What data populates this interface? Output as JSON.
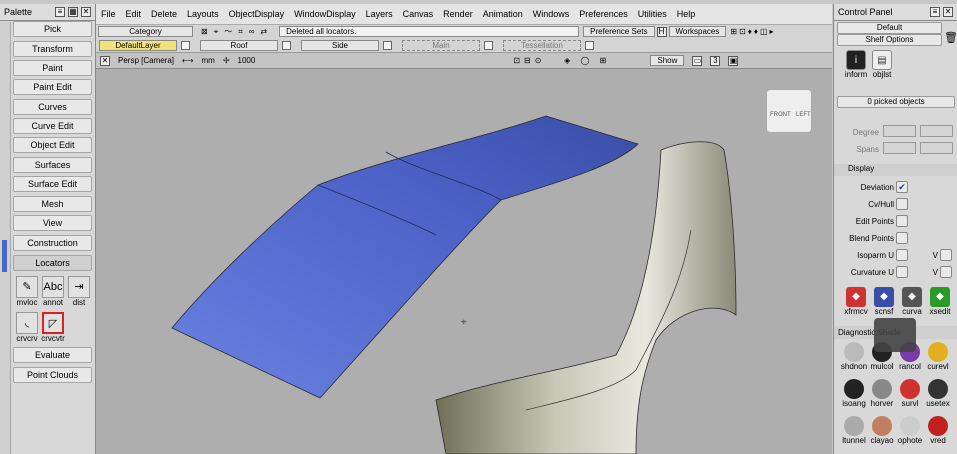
{
  "palette": {
    "title": "Palette",
    "buttons": [
      "Pick",
      "Transform",
      "Paint",
      "Paint Edit",
      "Curves",
      "Curve Edit",
      "Object Edit",
      "Surfaces",
      "Surface Edit",
      "Mesh",
      "View",
      "Construction",
      "Locators",
      "Evaluate",
      "Point Clouds"
    ],
    "tools": [
      {
        "label": "mvloc",
        "icon": "measure-icon"
      },
      {
        "label": "annot",
        "icon": "annotation-icon"
      },
      {
        "label": "dist",
        "icon": "distance-icon"
      },
      {
        "label": "crvcrv",
        "icon": "curve-curve-icon"
      },
      {
        "label": "crvcvtr",
        "icon": "curve-cv-icon"
      }
    ]
  },
  "menu": [
    "File",
    "Edit",
    "Delete",
    "Layouts",
    "ObjectDisplay",
    "WindowDisplay",
    "Layers",
    "Canvas",
    "Render",
    "Animation",
    "Windows",
    "Preferences",
    "Utilities",
    "Help"
  ],
  "toolbar": {
    "category": "Category",
    "status": "Deleted all locators.",
    "preference_sets": "Preference Sets",
    "workspaces": "Workspaces"
  },
  "layers": [
    {
      "label": "DefaultLayer",
      "style": "default"
    },
    {
      "label": "Roof",
      "style": "normal"
    },
    {
      "label": "Side",
      "style": "normal"
    },
    {
      "label": "Main",
      "style": "dash"
    },
    {
      "label": "Tessellation",
      "style": "dash"
    }
  ],
  "viewport": {
    "camera": "Persp [Camera]",
    "units": "mm",
    "scale": "1000",
    "show_label": "Show",
    "number": "3",
    "cube_front": "FRONT",
    "cube_left": "LEFT"
  },
  "control_panel": {
    "title": "Control Panel",
    "preset": "Default",
    "shelf_options": "Shelf Options",
    "shelf_items": [
      {
        "label": "inform",
        "icon": "info-icon"
      },
      {
        "label": "objlst",
        "icon": "object-list-icon"
      }
    ],
    "picked": "0 picked objects",
    "degree_label": "Degree",
    "spans_label": "Spans",
    "display_header": "Display",
    "display_rows": [
      {
        "label": "Deviation",
        "checked": true
      },
      {
        "label": "Cv/Hull",
        "checked": false
      },
      {
        "label": "Edit Points",
        "checked": false
      },
      {
        "label": "Blend Points",
        "checked": false
      },
      {
        "label": "Isoparm U",
        "checked": false,
        "v": "V"
      },
      {
        "label": "Curvature U",
        "checked": false,
        "v": "V"
      }
    ],
    "shelf2": [
      "xfrmcv",
      "scnsf",
      "curva",
      "xsedit"
    ],
    "diag_header": "Diagnostic Shade",
    "diag_items": [
      "shdnon",
      "mulcol",
      "rancol",
      "curevl",
      "isoang",
      "horver",
      "survl",
      "usetex",
      "ltunnel",
      "clayao",
      "ophote",
      "vred"
    ]
  },
  "colors": {
    "surface_blue": "#5a71d4",
    "accent": "#4668c8",
    "layer_default": "#f1e37a"
  }
}
